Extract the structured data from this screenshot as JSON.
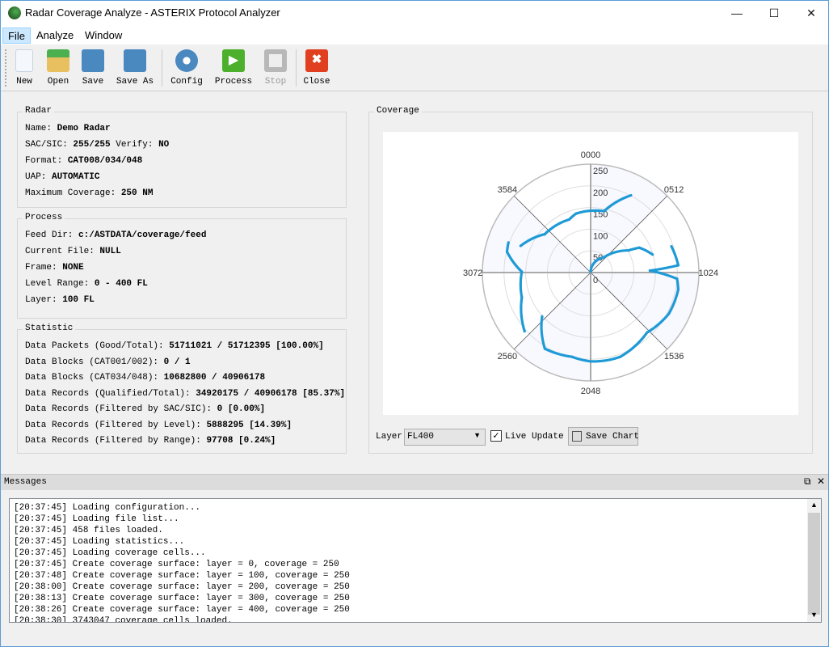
{
  "window": {
    "title": "Radar Coverage Analyze - ASTERIX Protocol Analyzer"
  },
  "menu": [
    "File",
    "Analyze",
    "Window"
  ],
  "toolbar": [
    {
      "label": "New",
      "icon": "new-file-icon"
    },
    {
      "label": "Open",
      "icon": "open-folder-icon"
    },
    {
      "label": "Save",
      "icon": "floppy-icon"
    },
    {
      "label": "Save As",
      "icon": "floppy-list-icon"
    },
    {
      "label": "Config",
      "icon": "gear-icon"
    },
    {
      "label": "Process",
      "icon": "play-icon"
    },
    {
      "label": "Stop",
      "icon": "stop-icon",
      "disabled": true
    },
    {
      "label": "Close",
      "icon": "close-red-icon"
    }
  ],
  "radar": {
    "title": "Radar",
    "rows": [
      [
        "Name: ",
        "Demo Radar"
      ],
      [
        "SAC/SIC: ",
        "255/255",
        " Verify: ",
        "NO"
      ],
      [
        "Format: ",
        "CAT008/034/048"
      ],
      [
        "UAP: ",
        "AUTOMATIC"
      ],
      [
        "Maximum Coverage: ",
        "250 NM"
      ]
    ]
  },
  "process": {
    "title": "Process",
    "rows": [
      [
        "Feed Dir: ",
        "c:/ASTDATA/coverage/feed"
      ],
      [
        "Current File: ",
        "NULL"
      ],
      [
        "Frame: ",
        "NONE"
      ],
      [
        "Level Range: ",
        "0 - 400 FL"
      ],
      [
        "Layer: ",
        "100 FL"
      ]
    ]
  },
  "statistic": {
    "title": "Statistic",
    "rows": [
      [
        "Data Packets (Good/Total): ",
        "51711021 / 51712395 [100.00%]"
      ],
      [
        "Data Blocks (CAT001/002): ",
        "0 / 1"
      ],
      [
        "Data Blocks (CAT034/048): ",
        "10682800 / 40906178"
      ],
      [
        "Data Records (Qualified/Total): ",
        "34920175 / 40906178 [85.37%]"
      ],
      [
        "Data Records (Filtered by SAC/SIC): ",
        "0 [0.00%]"
      ],
      [
        "Data Records (Filtered by Level): ",
        "5888295 [14.39%]"
      ],
      [
        "Data Records (Filtered by Range): ",
        "97708 [0.24%]"
      ]
    ]
  },
  "coverage": {
    "title": "Coverage",
    "layer_label": "Layer",
    "layer_value": "FL400",
    "live_update_label": "Live Update",
    "live_update_checked": true,
    "save_chart_label": "Save Chart"
  },
  "chart_data": {
    "type": "scatter",
    "polar": true,
    "angular_ticks": [
      "0000",
      "0512",
      "1024",
      "1536",
      "2048",
      "2560",
      "3072",
      "3584"
    ],
    "radial_ticks": [
      "0",
      "50",
      "100",
      "150",
      "200",
      "250"
    ],
    "rlim": [
      0,
      250
    ],
    "angular_range": [
      0,
      4096
    ],
    "point_color": "#1e9ad6",
    "shaded_sector_color": "#f8f8ff",
    "traces": [
      [
        [
          314,
          201
        ],
        [
          141,
          145
        ],
        [
          3936,
          140
        ],
        [
          3845,
          132
        ],
        [
          3525,
          138
        ],
        [
          3309,
          173
        ]
      ],
      [
        [
          0,
          2
        ],
        [
          470,
          47
        ],
        [
          679,
          101
        ],
        [
          716,
          126
        ],
        [
          840,
          149
        ]
      ],
      [
        [
          820,
          196
        ],
        [
          970,
          203
        ],
        [
          1003,
          137
        ],
        [
          1071,
          200
        ],
        [
          1149,
          206
        ],
        [
          1340,
          204
        ],
        [
          1556,
          190
        ],
        [
          1827,
          206
        ],
        [
          1909,
          206
        ],
        [
          2048,
          205
        ],
        [
          2191,
          199
        ],
        [
          2401,
          205
        ],
        [
          2593,
          151
        ]
      ],
      [
        [
          2598,
          204
        ],
        [
          2845,
          169
        ],
        [
          3080,
          159
        ],
        [
          3231,
          199
        ],
        [
          3300,
          202
        ]
      ]
    ]
  },
  "messages": {
    "title": "Messages",
    "lines": [
      "[20:37:45] Loading configuration...",
      "[20:37:45] Loading file list...",
      "[20:37:45] 458 files loaded.",
      "[20:37:45] Loading statistics...",
      "[20:37:45] Loading coverage cells...",
      "[20:37:45] Create coverage surface: layer = 0, coverage = 250",
      "[20:37:48] Create coverage surface: layer = 100, coverage = 250",
      "[20:38:00] Create coverage surface: layer = 200, coverage = 250",
      "[20:38:13] Create coverage surface: layer = 300, coverage = 250",
      "[20:38:26] Create coverage surface: layer = 400, coverage = 250",
      "[20:38:30] 3743047 coverage cells loaded."
    ]
  }
}
